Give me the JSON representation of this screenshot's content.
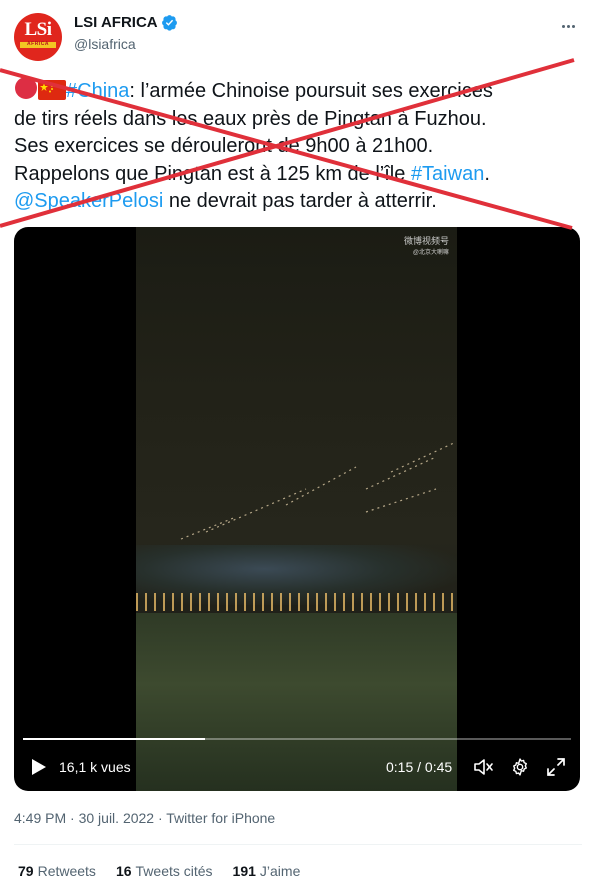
{
  "account": {
    "display_name": "LSI AFRICA",
    "handle": "@lsiafrica",
    "avatar_text": "LSi",
    "avatar_subtext": "AFRICA",
    "verified_icon": "verified-badge-icon",
    "more_icon": "more-options-icon"
  },
  "tweet": {
    "line1_pre": ":",
    "hashtag_china": "#China",
    "line1_text": ": l’armée Chinoise poursuit ses exercices",
    "line2_text": "de tirs réels dans les eaux près de Pingtan à Fuzhou.",
    "line3_text": "Ses exercices se dérouleront de 9h00 à 21h00.",
    "line4_pre": "Rappelons que Pingtan est à 125 km de l’île ",
    "hashtag_taiwan": "#Taiwan",
    "line4_post": ".",
    "mention": "@SpeakerPelosi",
    "line5_post": " ne devrait pas tarder à atterrir."
  },
  "video": {
    "watermark": "微博视频号",
    "watermark_sub": "@北京大喇嘛",
    "views": "16,1 k vues",
    "time": "0:15 / 0:45",
    "progress": 0.333
  },
  "meta": {
    "timestamp": "4:49 PM · 30 juil. 2022 · Twitter for iPhone"
  },
  "stats": {
    "retweets_count": "79",
    "retweets_label": "Retweets",
    "quotes_count": "16",
    "quotes_label": "Tweets cités",
    "likes_count": "191",
    "likes_label": "J’aime"
  },
  "colors": {
    "link": "#1d9bf0",
    "strike": "#e0303a",
    "avatar_bg": "#e0261d"
  }
}
